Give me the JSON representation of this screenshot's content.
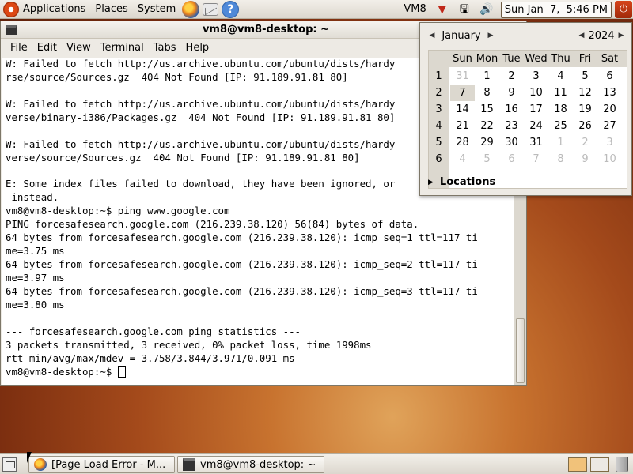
{
  "top_panel": {
    "menus": [
      "Applications",
      "Places",
      "System"
    ],
    "user_label": "VM8",
    "clock": "Sun Jan  7,  5:46 PM",
    "launchers": [
      "firefox-icon",
      "mail-icon",
      "help-icon"
    ],
    "tray_icons": [
      "update-notifier-icon",
      "network-icon",
      "volume-icon"
    ]
  },
  "terminal": {
    "title": "vm8@vm8-desktop: ~",
    "menus": [
      "File",
      "Edit",
      "View",
      "Terminal",
      "Tabs",
      "Help"
    ],
    "lines": [
      "W: Failed to fetch http://us.archive.ubuntu.com/ubuntu/dists/hardy",
      "rse/source/Sources.gz  404 Not Found [IP: 91.189.91.81 80]",
      "",
      "W: Failed to fetch http://us.archive.ubuntu.com/ubuntu/dists/hardy",
      "verse/binary-i386/Packages.gz  404 Not Found [IP: 91.189.91.81 80]",
      "",
      "W: Failed to fetch http://us.archive.ubuntu.com/ubuntu/dists/hardy",
      "verse/source/Sources.gz  404 Not Found [IP: 91.189.91.81 80]",
      "",
      "E: Some index files failed to download, they have been ignored, or",
      " instead.",
      "vm8@vm8-desktop:~$ ping www.google.com",
      "PING forcesafesearch.google.com (216.239.38.120) 56(84) bytes of data.",
      "64 bytes from forcesafesearch.google.com (216.239.38.120): icmp_seq=1 ttl=117 ti",
      "me=3.75 ms",
      "64 bytes from forcesafesearch.google.com (216.239.38.120): icmp_seq=2 ttl=117 ti",
      "me=3.97 ms",
      "64 bytes from forcesafesearch.google.com (216.239.38.120): icmp_seq=3 ttl=117 ti",
      "me=3.80 ms",
      "",
      "--- forcesafesearch.google.com ping statistics ---",
      "3 packets transmitted, 3 received, 0% packet loss, time 1998ms",
      "rtt min/avg/max/mdev = 3.758/3.844/3.971/0.091 ms"
    ],
    "prompt": "vm8@vm8-desktop:~$ "
  },
  "calendar": {
    "month": "January",
    "year": "2024",
    "weekdays": [
      "Sun",
      "Mon",
      "Tue",
      "Wed",
      "Thu",
      "Fri",
      "Sat"
    ],
    "weeks": [
      {
        "num": "1",
        "days": [
          {
            "d": "31",
            "dim": true
          },
          {
            "d": "1"
          },
          {
            "d": "2"
          },
          {
            "d": "3"
          },
          {
            "d": "4"
          },
          {
            "d": "5"
          },
          {
            "d": "6"
          }
        ]
      },
      {
        "num": "2",
        "days": [
          {
            "d": "7",
            "today": true
          },
          {
            "d": "8"
          },
          {
            "d": "9"
          },
          {
            "d": "10"
          },
          {
            "d": "11"
          },
          {
            "d": "12"
          },
          {
            "d": "13"
          }
        ]
      },
      {
        "num": "3",
        "days": [
          {
            "d": "14"
          },
          {
            "d": "15"
          },
          {
            "d": "16"
          },
          {
            "d": "17"
          },
          {
            "d": "18"
          },
          {
            "d": "19"
          },
          {
            "d": "20"
          }
        ]
      },
      {
        "num": "4",
        "days": [
          {
            "d": "21"
          },
          {
            "d": "22"
          },
          {
            "d": "23"
          },
          {
            "d": "24"
          },
          {
            "d": "25"
          },
          {
            "d": "26"
          },
          {
            "d": "27"
          }
        ]
      },
      {
        "num": "5",
        "days": [
          {
            "d": "28"
          },
          {
            "d": "29"
          },
          {
            "d": "30"
          },
          {
            "d": "31"
          },
          {
            "d": "1",
            "dim": true
          },
          {
            "d": "2",
            "dim": true
          },
          {
            "d": "3",
            "dim": true
          }
        ]
      },
      {
        "num": "6",
        "days": [
          {
            "d": "4",
            "dim": true
          },
          {
            "d": "5",
            "dim": true
          },
          {
            "d": "6",
            "dim": true
          },
          {
            "d": "7",
            "dim": true
          },
          {
            "d": "8",
            "dim": true
          },
          {
            "d": "9",
            "dim": true
          },
          {
            "d": "10",
            "dim": true
          }
        ]
      }
    ],
    "locations_label": "Locations"
  },
  "bottom_panel": {
    "tasks": [
      {
        "label": "[Page Load Error - M...",
        "icon": "firefox-icon"
      },
      {
        "label": "vm8@vm8-desktop: ~",
        "icon": "terminal-icon"
      }
    ]
  }
}
